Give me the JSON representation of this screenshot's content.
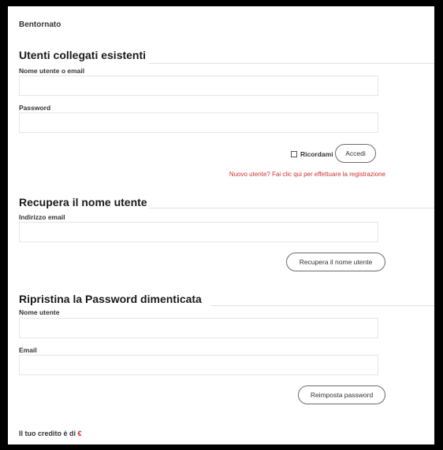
{
  "welcome": "Bentornato",
  "login": {
    "title": "Utenti collegati esistenti",
    "username_label": "Nome utente o email",
    "username_value": "",
    "password_label": "Password",
    "password_value": "",
    "remember_label": "Ricordami",
    "remember_checked": false,
    "submit_label": "Accedi",
    "register_link": "Nuovo utente? Fai clic qui per effettuare la registrazione"
  },
  "recover_username": {
    "title": "Recupera il nome utente",
    "email_label": "Indirizzo email",
    "email_value": "",
    "submit_label": "Recupera il nome utente"
  },
  "reset_password": {
    "title": "Ripristina la Password dimenticata",
    "username_label": "Nome utente",
    "username_value": "",
    "email_label": "Email",
    "email_value": "",
    "submit_label": "Reimposta password"
  },
  "credit": {
    "label": "Il tuo credito è di",
    "currency": "€"
  },
  "colors": {
    "accent": "#cc3333",
    "currency": "#dd2222",
    "border": "#e6e6e6"
  }
}
